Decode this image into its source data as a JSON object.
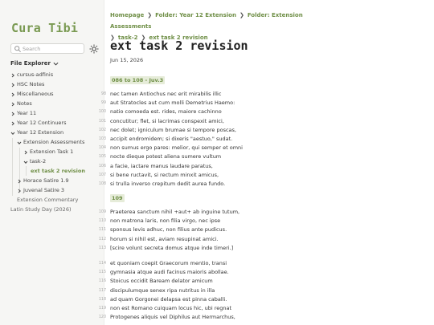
{
  "sidebar": {
    "logo": "Cura Tibi",
    "search_placeholder": "Search",
    "explorer_label": "File Explorer",
    "tree": [
      {
        "label": "cursus-adfinis"
      },
      {
        "label": "HSC Notes"
      },
      {
        "label": "Miscellaneous"
      },
      {
        "label": "Notes"
      },
      {
        "label": "Year 11"
      },
      {
        "label": "Year 12 Continuers"
      },
      {
        "label": "Year 12 Extension"
      },
      {
        "label": "Extension Assessments"
      },
      {
        "label": "Extension Task 1"
      },
      {
        "label": "task-2"
      },
      {
        "label": "ext task 2 revision"
      },
      {
        "label": "Horace Satire 1.9"
      },
      {
        "label": "Juvenal Satire 3"
      },
      {
        "label": "Extension Commentary"
      },
      {
        "label": "Latin Study Day (2026)"
      }
    ]
  },
  "breadcrumb": [
    "Homepage",
    "Folder: Year 12 Extension",
    "Folder: Extension Assessments",
    "task-2",
    "ext task 2 revision"
  ],
  "page": {
    "title": "ext task 2 revision",
    "date": "Jun 15, 2026"
  },
  "sections": [
    {
      "heading": "086 to 108 - Juv.3",
      "lines": [
        {
          "n": "98",
          "t": "nec tamen Antiochus nec erit mirabilis illic"
        },
        {
          "n": "99",
          "t": "aut Stratocles aut cum molli Demetrius Haemo:"
        },
        {
          "n": "100",
          "t": "natio comoeda est. rides, maiore cachinno"
        },
        {
          "n": "101",
          "t": "concutitur; flet, si lacrimas conspexit amici,"
        },
        {
          "n": "102",
          "t": "nec dolet; igniculum brumae si tempore poscas,"
        },
        {
          "n": "103",
          "t": "accipit endromidem; si dixeris \"aestuo,\" sudat."
        },
        {
          "n": "104",
          "t": "non sumus ergo pares: melior, qui semper et omni"
        },
        {
          "n": "105",
          "t": "nocte dieque potest aliena sumere vultum"
        },
        {
          "n": "106",
          "t": "a facie, iactare manus laudare paratus,"
        },
        {
          "n": "107",
          "t": "si bene ructavit, si rectum minxit amicus,"
        },
        {
          "n": "108",
          "t": "si trulla inverso crepitum dedit aurea fundo."
        }
      ]
    },
    {
      "heading": "109",
      "lines": [
        {
          "n": "109",
          "t": "Praeterea sanctum nihil +aut+ ab inguine tutum,"
        },
        {
          "n": "110",
          "t": "non matrona laris, non filia virgo, nec ipse"
        },
        {
          "n": "111",
          "t": "sponsus levis adhuc, non filius ante pudicus."
        },
        {
          "n": "112",
          "t": "horum si nihil est, aviam resupinat amici."
        },
        {
          "n": "113",
          "t": "[scire volunt secreta domus atque inde timeri.]"
        },
        {
          "n": "114",
          "t": "et quoniam coepit Graecorum mentio, transi"
        },
        {
          "n": "115",
          "t": "gymnasia atque audi facinus maioris abollae."
        },
        {
          "n": "116",
          "t": "Stoicus occidit Baream delator amicum"
        },
        {
          "n": "117",
          "t": "discipulumque senex ripa nutritus in illa"
        },
        {
          "n": "118",
          "t": "ad quam Gorgonei delapsa est pinna caballi."
        },
        {
          "n": "119",
          "t": "non est Romano cuiquam locus hic, ubi regnat"
        },
        {
          "n": "120",
          "t": "Protogenes aliquis vel Diphilus aut Hermarchus,"
        }
      ]
    }
  ],
  "colors": {
    "accent": "#6e8e45",
    "tag_bg": "#e6ecd9",
    "sidebar_bg": "#f6f6f4"
  }
}
